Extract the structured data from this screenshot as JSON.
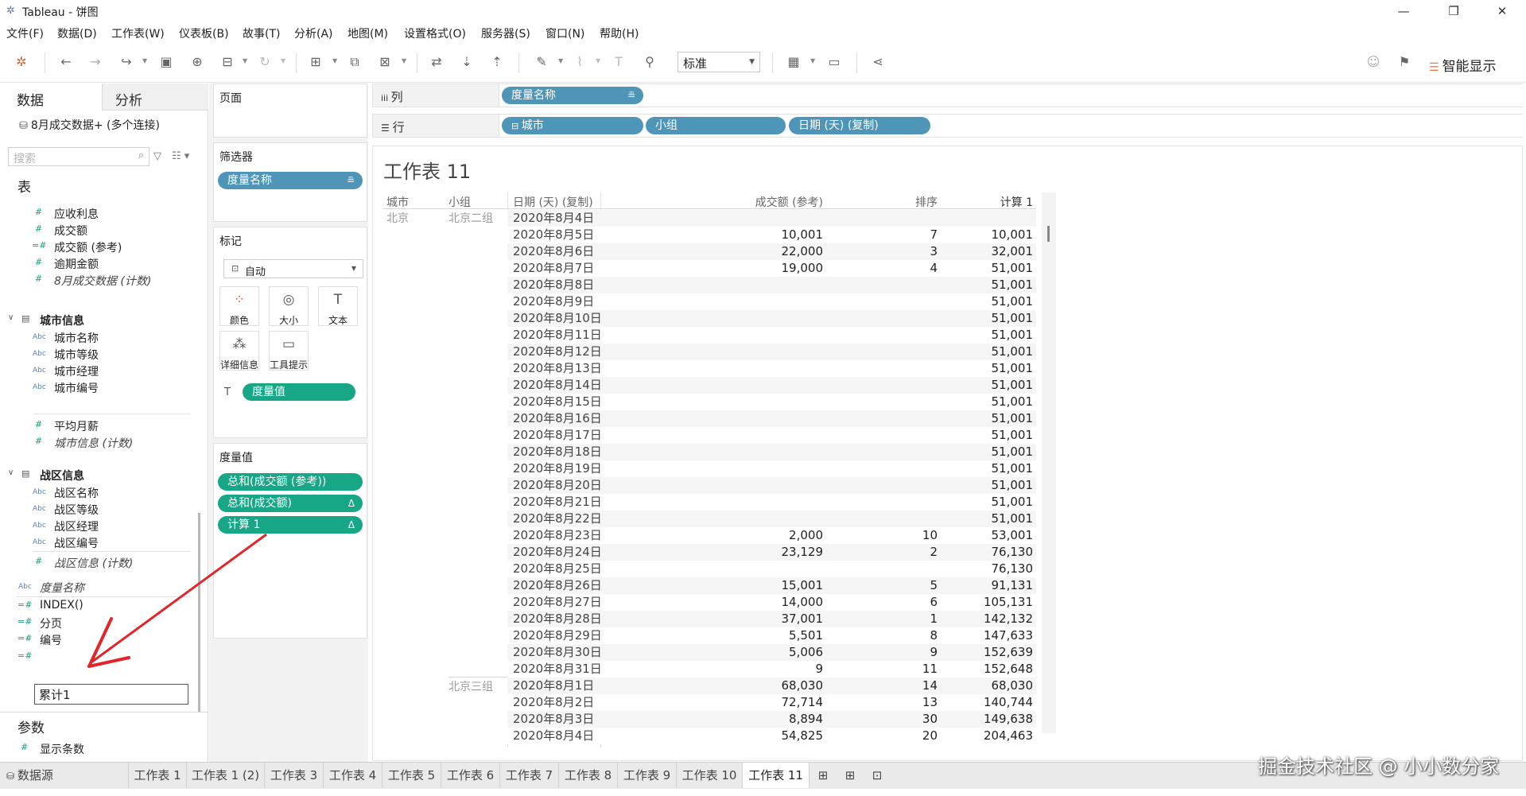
{
  "window": {
    "app_icon": "tableau-logo-icon",
    "title": "Tableau - 饼图",
    "minimize": "—",
    "maximize": "❐",
    "close": "✕"
  },
  "menu": [
    "文件(F)",
    "数据(D)",
    "工作表(W)",
    "仪表板(B)",
    "故事(T)",
    "分析(A)",
    "地图(M)",
    "设置格式(O)",
    "服务器(S)",
    "窗口(N)",
    "帮助(H)"
  ],
  "toolbar": {
    "fit_select": "标准",
    "smart_show": "智能显示"
  },
  "data_pane": {
    "tab_data": "数据",
    "tab_analysis": "分析",
    "datasource": "8月成交数据+ (多个连接)",
    "search_placeholder": "搜索",
    "tables_header": "表",
    "fields_top": [
      "应收利息",
      "成交额",
      "成交额 (参考)",
      "逾期金额",
      "8月成交数据 (计数)"
    ],
    "group_city": "城市信息",
    "city_fields": [
      "城市名称",
      "城市等级",
      "城市经理",
      "城市编号"
    ],
    "city_measures": [
      "平均月薪",
      "城市信息 (计数)"
    ],
    "group_district": "战区信息",
    "district_fields": [
      "战区名称",
      "战区等级",
      "战区经理",
      "战区编号"
    ],
    "district_measures": [
      "战区信息 (计数)"
    ],
    "loose_fields": [
      "度量名称",
      "INDEX()",
      "分页",
      "编号"
    ],
    "rename_value": "累计1",
    "params_header": "参数",
    "params": [
      "显示条数"
    ]
  },
  "cards": {
    "pages": "页面",
    "filters": "筛选器",
    "filter_pill": "度量名称",
    "marks": "标记",
    "mark_type": "自动",
    "mark_buttons": [
      "颜色",
      "大小",
      "文本",
      "详细信息",
      "工具提示"
    ],
    "marks_pill": "度量值",
    "measure_values": "度量值",
    "mv_pills": [
      "总和(成交额 (参考))",
      "总和(成交额)",
      "计算 1"
    ],
    "delta": "Δ"
  },
  "shelves": {
    "columns_label": "列",
    "rows_label": "行",
    "columns_pill": "度量名称",
    "rows_pills": [
      "城市",
      "小组",
      "日期 (天) (复制)"
    ]
  },
  "view": {
    "title": "工作表 11",
    "headers": [
      "城市",
      "小组",
      "日期 (天) (复制)",
      "成交额 (参考)",
      "排序",
      "计算 1"
    ],
    "city": "北京",
    "groups": [
      "北京二组",
      "北京三组"
    ],
    "rows": [
      [
        "2020年8月4日",
        "",
        "",
        ""
      ],
      [
        "2020年8月5日",
        "10,001",
        "7",
        "10,001"
      ],
      [
        "2020年8月6日",
        "22,000",
        "3",
        "32,001"
      ],
      [
        "2020年8月7日",
        "19,000",
        "4",
        "51,001"
      ],
      [
        "2020年8月8日",
        "",
        "",
        "51,001"
      ],
      [
        "2020年8月9日",
        "",
        "",
        "51,001"
      ],
      [
        "2020年8月10日",
        "",
        "",
        "51,001"
      ],
      [
        "2020年8月11日",
        "",
        "",
        "51,001"
      ],
      [
        "2020年8月12日",
        "",
        "",
        "51,001"
      ],
      [
        "2020年8月13日",
        "",
        "",
        "51,001"
      ],
      [
        "2020年8月14日",
        "",
        "",
        "51,001"
      ],
      [
        "2020年8月15日",
        "",
        "",
        "51,001"
      ],
      [
        "2020年8月16日",
        "",
        "",
        "51,001"
      ],
      [
        "2020年8月17日",
        "",
        "",
        "51,001"
      ],
      [
        "2020年8月18日",
        "",
        "",
        "51,001"
      ],
      [
        "2020年8月19日",
        "",
        "",
        "51,001"
      ],
      [
        "2020年8月20日",
        "",
        "",
        "51,001"
      ],
      [
        "2020年8月21日",
        "",
        "",
        "51,001"
      ],
      [
        "2020年8月22日",
        "",
        "",
        "51,001"
      ],
      [
        "2020年8月23日",
        "2,000",
        "10",
        "53,001"
      ],
      [
        "2020年8月24日",
        "23,129",
        "2",
        "76,130"
      ],
      [
        "2020年8月25日",
        "",
        "",
        "76,130"
      ],
      [
        "2020年8月26日",
        "15,001",
        "5",
        "91,131"
      ],
      [
        "2020年8月27日",
        "14,000",
        "6",
        "105,131"
      ],
      [
        "2020年8月28日",
        "37,001",
        "1",
        "142,132"
      ],
      [
        "2020年8月29日",
        "5,501",
        "8",
        "147,633"
      ],
      [
        "2020年8月30日",
        "5,006",
        "9",
        "152,639"
      ],
      [
        "2020年8月31日",
        "9",
        "11",
        "152,648"
      ],
      [
        "2020年8月1日",
        "68,030",
        "14",
        "68,030"
      ],
      [
        "2020年8月2日",
        "72,714",
        "13",
        "140,744"
      ],
      [
        "2020年8月3日",
        "8,894",
        "30",
        "149,638"
      ],
      [
        "2020年8月4日",
        "54,825",
        "20",
        "204,463"
      ]
    ]
  },
  "sheet_tabs": {
    "datasource_tab": "数据源",
    "tabs": [
      "工作表 1",
      "工作表 1 (2)",
      "工作表 3",
      "工作表 4",
      "工作表 5",
      "工作表 6",
      "工作表 7",
      "工作表 8",
      "工作表 9",
      "工作表 10",
      "工作表 11"
    ],
    "active": "工作表 11"
  },
  "watermark": "掘金技术社区 @ 小小数分家",
  "colors": {
    "pill_blue": "#4e95b8",
    "pill_green": "#17a787",
    "annotation_arrow": "#e0262b"
  }
}
